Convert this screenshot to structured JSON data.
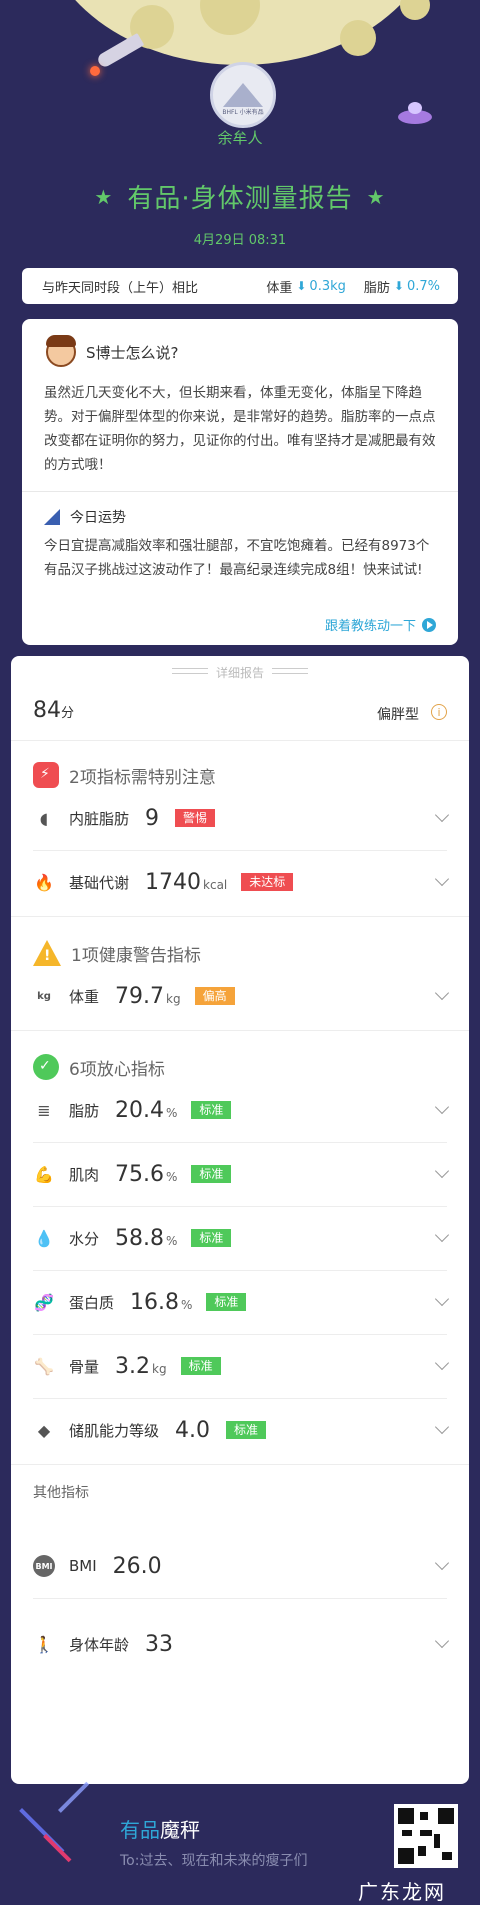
{
  "header": {
    "username": "余牟人",
    "avatar_text": "BHFL 小米有品",
    "title": "有品·身体测量报告",
    "title_star": "★",
    "date": "4月29日 08:31"
  },
  "compare": {
    "label": "与昨天同时段（上午）相比",
    "weight_label": "体重",
    "weight_change": "0.3kg",
    "fat_label": "脂肪",
    "fat_change": "0.7%",
    "arrow": "⬇"
  },
  "advice": {
    "title": "S博士怎么说?",
    "body": "虽然近几天变化不大，但长期来看，体重无变化，体脂呈下降趋势。对于偏胖型体型的你来说，是非常好的趋势。脂肪率的一点点改变都在证明你的努力，见证你的付出。唯有坚持才是减肥最有效的方式哦！",
    "fortune_title": "今日运势",
    "fortune_body": "今日宜提高减脂效率和强壮腿部，不宜吃饱瘫着。已经有8973个有品汉子挑战过这波动作了！最高纪录连续完成8组！快来试试!",
    "fortune_link": "跟着教练动一下"
  },
  "detail": {
    "tag": "详细报告",
    "score": "84",
    "score_unit": "分",
    "body_type": "偏胖型",
    "info_icon": "i",
    "sections": [
      {
        "title": "2项指标需特别注意",
        "badge_mark": "⚡"
      },
      {
        "title": "1项健康警告指标",
        "badge_mark": "!"
      },
      {
        "title": "6项放心指标",
        "badge_mark": "✓"
      }
    ],
    "rows": [
      {
        "name": "内脏脂肪",
        "value": "9",
        "unit": "",
        "tag": "警惕",
        "icon_glyph": "◖",
        "icon_name": "organ-icon"
      },
      {
        "name": "基础代谢",
        "value": "1740",
        "unit": "kcal",
        "tag": "未达标",
        "icon_glyph": "🔥",
        "icon_name": "flame-icon"
      },
      {
        "name": "体重",
        "value": "79.7",
        "unit": "kg",
        "tag": "偏高",
        "icon_glyph": "kg",
        "icon_name": "weight-icon"
      },
      {
        "name": "脂肪",
        "value": "20.4",
        "unit": "%",
        "tag": "标准",
        "icon_glyph": "≣",
        "icon_name": "fat-icon"
      },
      {
        "name": "肌肉",
        "value": "75.6",
        "unit": "%",
        "tag": "标准",
        "icon_glyph": "💪",
        "icon_name": "muscle-icon"
      },
      {
        "name": "水分",
        "value": "58.8",
        "unit": "%",
        "tag": "标准",
        "icon_glyph": "💧",
        "icon_name": "water-drop-icon"
      },
      {
        "name": "蛋白质",
        "value": "16.8",
        "unit": "%",
        "tag": "标准",
        "icon_glyph": "🧬",
        "icon_name": "dna-icon"
      },
      {
        "name": "骨量",
        "value": "3.2",
        "unit": "kg",
        "tag": "标准",
        "icon_glyph": "🦴",
        "icon_name": "bone-icon"
      },
      {
        "name": "储肌能力等级",
        "value": "4.0",
        "unit": "",
        "tag": "标准",
        "icon_glyph": "◆",
        "icon_name": "muscle-storage-icon"
      }
    ],
    "other_label": "其他指标",
    "other_rows": [
      {
        "name": "BMI",
        "value": "26.0",
        "icon_glyph": "BMI",
        "icon_name": "bmi-icon"
      },
      {
        "name": "身体年龄",
        "value": "33",
        "icon_glyph": "🚶",
        "icon_name": "body-age-icon"
      }
    ]
  },
  "footer": {
    "brand_1": "有品",
    "brand_2": "魔秤",
    "slogan": "To:过去、现在和未来的瘦子们",
    "watermark": "广东龙网"
  },
  "colors": {
    "background": "#2c2a5c",
    "accent_green": "#62c86a",
    "accent_blue": "#2fa7d7",
    "warn_red": "#ef4d51",
    "warn_orange": "#f5a33a",
    "ok_green": "#4fc95a"
  }
}
